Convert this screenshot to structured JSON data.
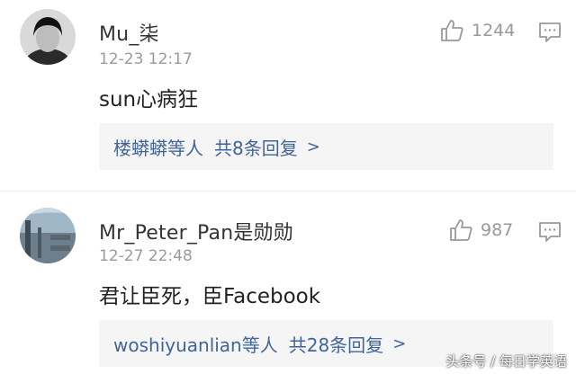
{
  "comments": [
    {
      "username": "Mu_柒",
      "time": "12-23 12:17",
      "text": "sun心病狂",
      "likes": "1244",
      "replies": {
        "names": "楼蟒蟒等人",
        "count_label": "共8条回复",
        "chevron": ">"
      }
    },
    {
      "username": "Mr_Peter_Pan是勋勋",
      "time": "12-27 22:48",
      "text": "君让臣死，臣Facebook",
      "likes": "987",
      "replies": {
        "names": "woshiyuanlian等人",
        "count_label": "共28条回复",
        "chevron": ">"
      }
    }
  ],
  "watermark": "头条号 / 每日学英语",
  "icons": {
    "like": "thumbs-up-icon",
    "reply": "comment-bubble-icon"
  },
  "colors": {
    "link": "#406599",
    "meta": "#9a9a9a",
    "reply_bg": "#f5f5f5"
  }
}
